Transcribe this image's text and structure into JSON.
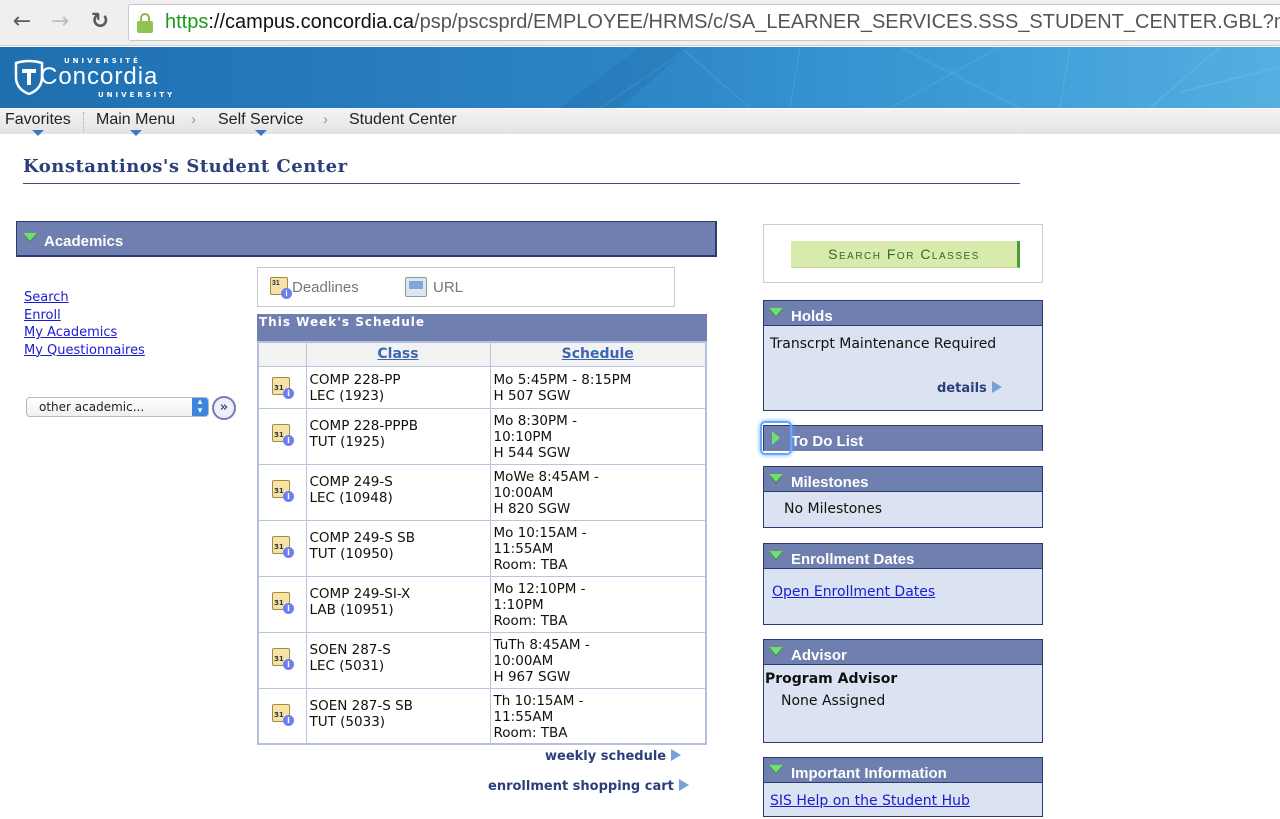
{
  "browser": {
    "url_scheme": "https",
    "url_host": "://campus.concordia.ca",
    "url_path": "/psp/pscsprd/EMPLOYEE/HRMS/c/SA_LEARNER_SERVICES.SSS_STUDENT_CENTER.GBL?null",
    "back_glyph": "←",
    "forward_glyph": "→",
    "reload_glyph": "↻"
  },
  "banner": {
    "logo_top": "UNIVERSITÉ",
    "logo_name": "Concordia",
    "logo_bottom": "UNIVERSITY"
  },
  "menubar": {
    "items": [
      {
        "label": "Favorites"
      },
      {
        "label": "Main Menu"
      },
      {
        "label": "Self Service"
      },
      {
        "label": "Student Center"
      }
    ],
    "chevron": "›"
  },
  "page": {
    "title": "Konstantinos's Student Center"
  },
  "academics": {
    "header": "Academics",
    "links": [
      "Search",
      "Enroll",
      "My Academics",
      "My Questionnaires"
    ],
    "select_value": "other academic...",
    "go_glyph": "»",
    "tools": {
      "deadlines": "Deadlines",
      "url": "URL"
    },
    "schedule": {
      "title": "This Week's Schedule",
      "columns": [
        "",
        "Class",
        "Schedule"
      ],
      "rows": [
        {
          "class": [
            "COMP 228-PP",
            "LEC (1923)"
          ],
          "schedule": [
            "Mo 5:45PM - 8:15PM",
            "H 507 SGW"
          ]
        },
        {
          "class": [
            "COMP 228-PPPB",
            "TUT (1925)"
          ],
          "schedule": [
            "Mo 8:30PM -",
            "10:10PM",
            "H 544 SGW"
          ]
        },
        {
          "class": [
            "COMP 249-S",
            "LEC (10948)"
          ],
          "schedule": [
            "MoWe 8:45AM -",
            "10:00AM",
            "H 820 SGW"
          ]
        },
        {
          "class": [
            "COMP 249-S SB",
            "TUT (10950)"
          ],
          "schedule": [
            "Mo 10:15AM -",
            "11:55AM",
            "Room:  TBA"
          ]
        },
        {
          "class": [
            "COMP 249-SI-X",
            "LAB (10951)"
          ],
          "schedule": [
            "Mo 12:10PM -",
            "1:10PM",
            "Room:  TBA"
          ]
        },
        {
          "class": [
            "SOEN 287-S",
            "LEC (5031)"
          ],
          "schedule": [
            "TuTh 8:45AM -",
            "10:00AM",
            "H 967 SGW"
          ]
        },
        {
          "class": [
            "SOEN 287-S SB",
            "TUT (5033)"
          ],
          "schedule": [
            "Th 10:15AM -",
            "11:55AM",
            "Room:  TBA"
          ]
        }
      ]
    },
    "weekly_schedule_link": "weekly schedule",
    "shopping_cart_link": "enrollment shopping cart"
  },
  "right": {
    "search_button": "Search For Classes",
    "holds": {
      "header": "Holds",
      "item": "Transcrpt Maintenance Required",
      "details": "details"
    },
    "todo": {
      "header": "To Do List"
    },
    "milestones": {
      "header": "Milestones",
      "text": "No Milestones"
    },
    "enrollment_dates": {
      "header": "Enrollment Dates",
      "link": "Open Enrollment Dates"
    },
    "advisor": {
      "header": "Advisor",
      "label": "Program Advisor",
      "value": "None Assigned"
    },
    "important_info": {
      "header": "Important Information",
      "link": "SIS Help on the Student Hub"
    }
  },
  "colors": {
    "section_header": "#6f7faf",
    "panel_body": "#dbe3f2",
    "title": "#2b3f7a",
    "link": "#1b1bd0",
    "search_button_bg": "#d8ebac"
  }
}
